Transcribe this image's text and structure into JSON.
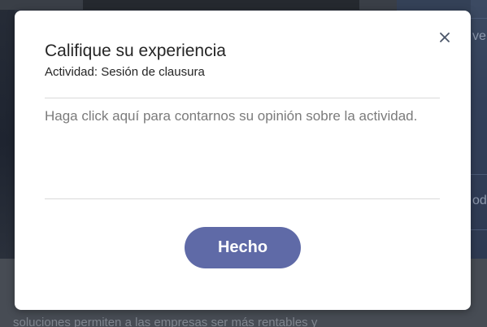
{
  "background": {
    "right_fragment_top": "ve",
    "right_fragment_mid": "od",
    "bottom_text": "soluciones permiten a las empresas ser más rentables y"
  },
  "modal": {
    "title": "Califique su experiencia",
    "subtitle": "Actividad: Sesión de clausura",
    "feedback_placeholder": "Haga click aquí para contarnos su opinión sobre la actividad.",
    "feedback_value": "",
    "done_label": "Hecho",
    "close_icon": "close-icon"
  },
  "colors": {
    "primary_button": "#5f6aa7",
    "modal_background": "#ffffff",
    "text": "#252525",
    "placeholder": "#7b7b7b"
  }
}
